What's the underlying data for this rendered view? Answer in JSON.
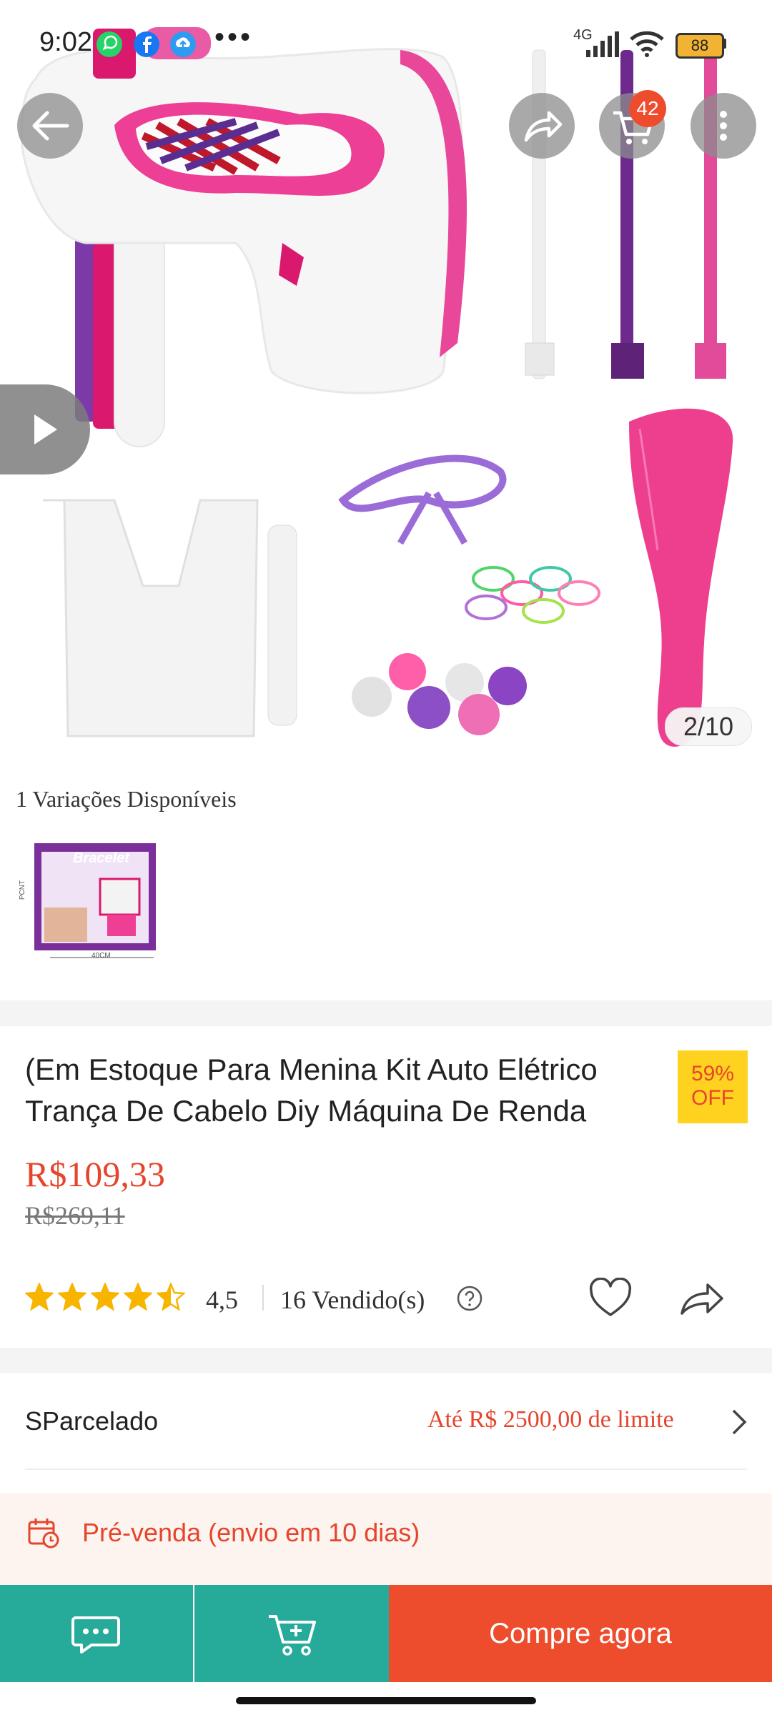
{
  "status_bar": {
    "time": "9:02",
    "dots": "•••",
    "network": "4G",
    "battery": "88"
  },
  "gallery": {
    "counter": "2/10",
    "cart_count": "42"
  },
  "variations": {
    "label": "1 Variações Disponíveis",
    "thumb_brand": "Bracelet",
    "thumb_side": "PCNT",
    "thumb_bottom": "40CM"
  },
  "product": {
    "title": "(Em Estoque Para Menina Kit Auto Elétrico Trança De Cabelo Diy Máquina De Renda",
    "discount_percent": "59%",
    "discount_off": "OFF",
    "price": "R$109,33",
    "old_price": "R$269,11",
    "rating": "4,5",
    "rating_stars": 4.5,
    "sold": "16 Vendido(s)"
  },
  "installment": {
    "label": "SParcelado",
    "limit": "Até R$ 2500,00 de limite"
  },
  "presale": {
    "text": "Pré-venda (envio em 10 dias)"
  },
  "actions": {
    "buy_now": "Compre agora"
  },
  "colors": {
    "accent": "#ee4d2d",
    "teal": "#26aa99",
    "star": "#f7b500",
    "discount_bg": "#ffd21f"
  }
}
